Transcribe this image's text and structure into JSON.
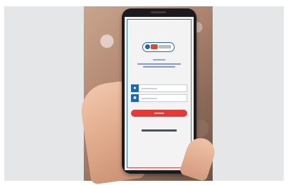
{
  "image": {
    "subject": "smartphone-login-screen",
    "screen": {
      "logo": "app-logo",
      "icons": [
        "user-icon",
        "lock-icon"
      ]
    }
  }
}
